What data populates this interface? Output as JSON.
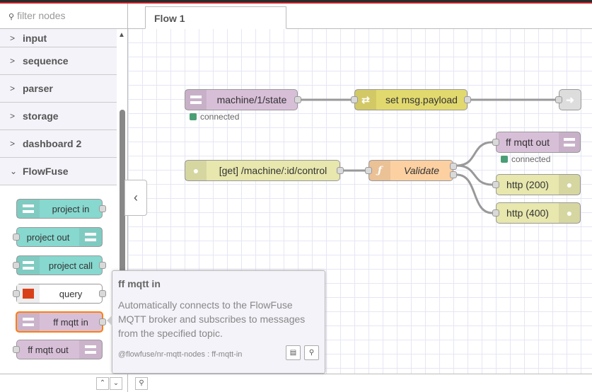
{
  "palette": {
    "filter_placeholder": "filter nodes",
    "categories": [
      {
        "label": "input",
        "expanded": false
      },
      {
        "label": "sequence",
        "expanded": false
      },
      {
        "label": "parser",
        "expanded": false
      },
      {
        "label": "storage",
        "expanded": false
      },
      {
        "label": "dashboard 2",
        "expanded": false
      },
      {
        "label": "FlowFuse",
        "expanded": true
      }
    ],
    "nodes": [
      {
        "label": "project in",
        "color": "#87d8cf"
      },
      {
        "label": "project out",
        "color": "#87d8cf"
      },
      {
        "label": "project call",
        "color": "#87d8cf"
      },
      {
        "label": "query",
        "color": "#ffffff"
      },
      {
        "label": "ff mqtt in",
        "color": "#d8bfd8"
      },
      {
        "label": "ff mqtt out",
        "color": "#d8bfd8"
      }
    ]
  },
  "tabs": [
    {
      "label": "Flow 1",
      "active": true
    }
  ],
  "flow": {
    "nodes": {
      "mqtt_in": {
        "label": "machine/1/state",
        "status": "connected",
        "color": "#d8bfd8"
      },
      "change": {
        "label": "set msg.payload",
        "color": "#e2d96e"
      },
      "link_out": {
        "label": "",
        "color": "#dddddd"
      },
      "http_in": {
        "label": "[get] /machine/:id/control",
        "color": "#e7e7ae"
      },
      "function": {
        "label": "Validate",
        "color": "#fdd0a2"
      },
      "mqtt_out": {
        "label": "ff mqtt out",
        "status": "connected",
        "color": "#d8bfd8"
      },
      "http_200": {
        "label": "http (200)",
        "color": "#e7e7ae"
      },
      "http_400": {
        "label": "http (400)",
        "color": "#e7e7ae"
      }
    }
  },
  "tooltip": {
    "title": "ff mqtt in",
    "description": "Automatically connects to the FlowFuse MQTT broker and subscribes to messages from the specified topic.",
    "module": "@flowfuse/nr-mqtt-nodes : ff-mqtt-in"
  },
  "colors": {
    "accent_red": "#c4232b",
    "selected_outline": "#ff7f0e",
    "status_green": "#4a9e76"
  }
}
